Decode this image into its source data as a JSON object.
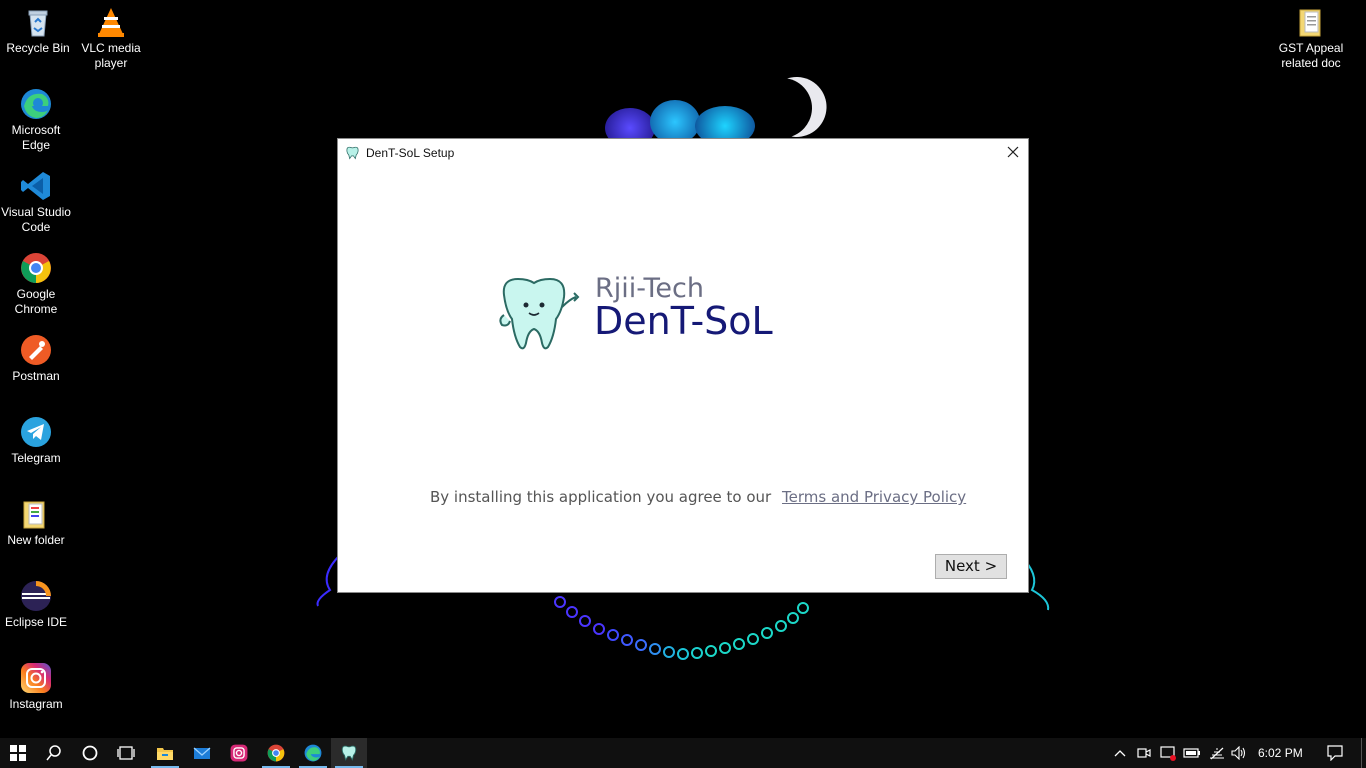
{
  "desktop": {
    "icons_left": [
      {
        "label": "Recycle Bin",
        "icon": "recycle-bin-icon"
      },
      {
        "label": "VLC media player",
        "icon": "vlc-icon"
      },
      {
        "label": "Microsoft Edge",
        "icon": "edge-icon"
      },
      {
        "label": "Visual Studio Code",
        "icon": "vscode-icon"
      },
      {
        "label": "Google Chrome",
        "icon": "chrome-icon"
      },
      {
        "label": "Postman",
        "icon": "postman-icon"
      },
      {
        "label": "Telegram",
        "icon": "telegram-icon"
      },
      {
        "label": "New folder",
        "icon": "folder-icon"
      },
      {
        "label": "Eclipse IDE",
        "icon": "eclipse-icon"
      },
      {
        "label": "Instagram",
        "icon": "instagram-icon"
      }
    ],
    "icons_right": [
      {
        "label": "GST Appeal related doc",
        "icon": "folder-icon"
      }
    ]
  },
  "dialog": {
    "title": "DenT-SoL Setup",
    "brand_company": "Rjii-Tech",
    "brand_product": "DenT-SoL",
    "agree_text": "By installing this application you agree to our",
    "agree_link": "Terms and Privacy Policy",
    "next_label": "Next >"
  },
  "taskbar": {
    "apps": [
      "start-icon",
      "search-icon",
      "cortana-icon",
      "task-view-icon",
      "file-explorer-icon",
      "mail-icon",
      "instagram-icon",
      "chrome-icon",
      "edge-icon",
      "dent-sol-icon"
    ],
    "time": "6:02 PM"
  },
  "colors": {
    "brand_company": "#6b6e84",
    "brand_product": "#151976",
    "taskbar_accent": "#76b9ed"
  }
}
